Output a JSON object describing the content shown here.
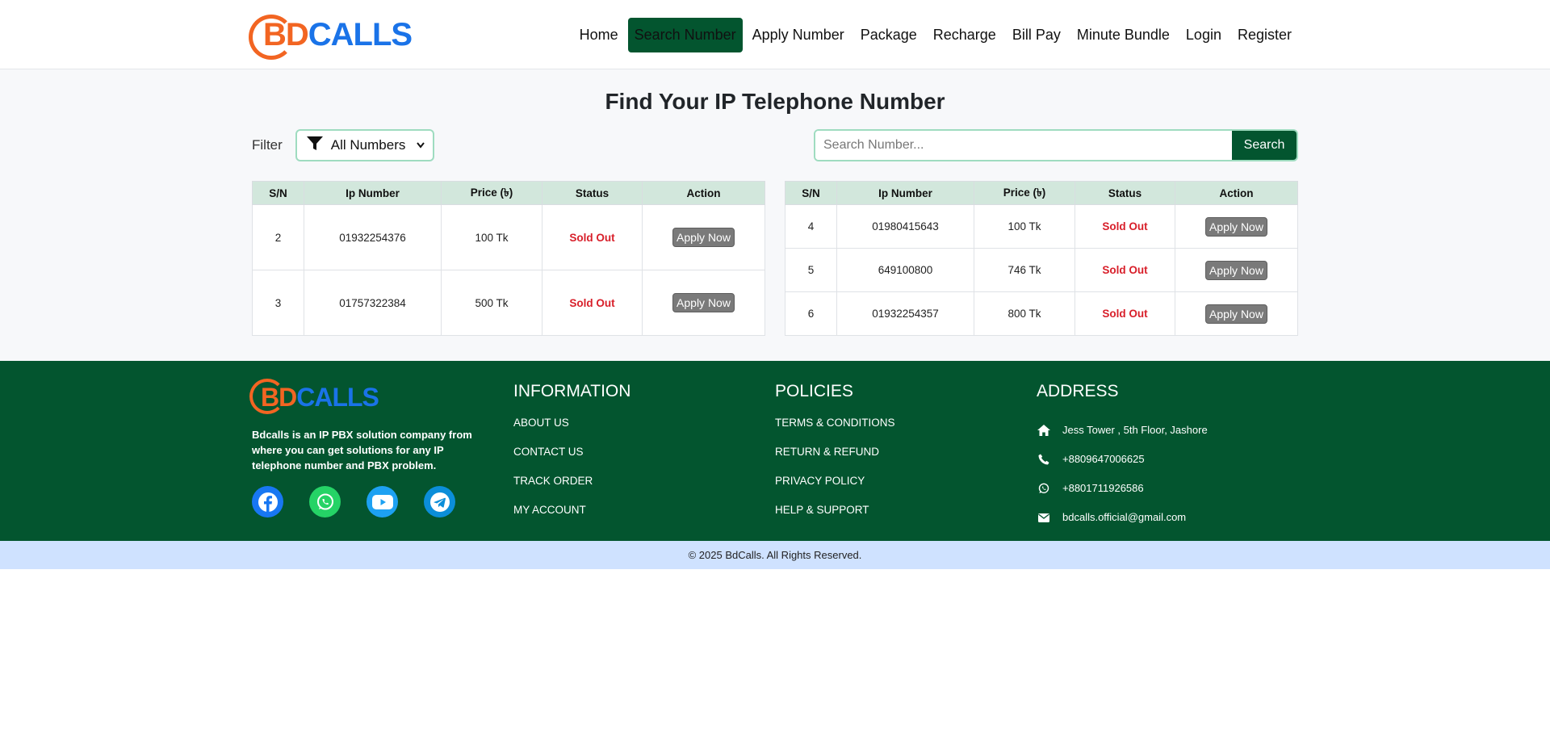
{
  "brand": {
    "bd": "BD",
    "calls": "CALLS"
  },
  "nav": {
    "items": [
      {
        "label": "Home",
        "active": false
      },
      {
        "label": "Search Number",
        "active": true
      },
      {
        "label": "Apply Number",
        "active": false
      },
      {
        "label": "Package",
        "active": false
      },
      {
        "label": "Recharge",
        "active": false
      },
      {
        "label": "Bill Pay",
        "active": false
      },
      {
        "label": "Minute Bundle",
        "active": false
      },
      {
        "label": "Login",
        "active": false
      },
      {
        "label": "Register",
        "active": false
      }
    ]
  },
  "main": {
    "title": "Find Your IP Telephone Number",
    "filter": {
      "label": "Filter",
      "selected": "All Numbers"
    },
    "search": {
      "placeholder": "Search Number...",
      "button": "Search"
    },
    "columns": [
      "S/N",
      "Ip Number",
      "Price (৳)",
      "Status",
      "Action"
    ],
    "left_rows": [
      {
        "sn": "2",
        "ip": "01932254376",
        "price": "100 Tk",
        "status": "Sold Out",
        "action": "Apply Now"
      },
      {
        "sn": "3",
        "ip": "01757322384",
        "price": "500 Tk",
        "status": "Sold Out",
        "action": "Apply Now"
      }
    ],
    "right_rows": [
      {
        "sn": "4",
        "ip": "01980415643",
        "price": "100 Tk",
        "status": "Sold Out",
        "action": "Apply Now"
      },
      {
        "sn": "5",
        "ip": "649100800",
        "price": "746 Tk",
        "status": "Sold Out",
        "action": "Apply Now"
      },
      {
        "sn": "6",
        "ip": "01932254357",
        "price": "800 Tk",
        "status": "Sold Out",
        "action": "Apply Now"
      }
    ]
  },
  "footer": {
    "description": "Bdcalls is an IP PBX solution company from where you can get solutions for any IP telephone number and PBX problem.",
    "socials": [
      "facebook-icon",
      "whatsapp-icon",
      "youtube-icon",
      "telegram-icon"
    ],
    "information": {
      "heading": "INFORMATION",
      "links": [
        "ABOUT US",
        "CONTACT US",
        "TRACK ORDER",
        "MY ACCOUNT"
      ]
    },
    "policies": {
      "heading": "POLICIES",
      "links": [
        "TERMS & CONDITIONS",
        "RETURN & REFUND",
        "PRIVACY POLICY",
        "HELP & SUPPORT"
      ]
    },
    "address": {
      "heading": "ADDRESS",
      "location": "Jess Tower , 5th Floor, Jashore",
      "phone": "+8809647006625",
      "whatsapp": "+8801711926586",
      "email": "bdcalls.official@gmail.com"
    },
    "copyright": "© 2025 BdCalls. All Rights Reserved."
  },
  "colors": {
    "primary": "#03552f",
    "accent_orange": "#f26522",
    "accent_blue": "#1a73e8",
    "sold_out": "#d81f2a"
  }
}
